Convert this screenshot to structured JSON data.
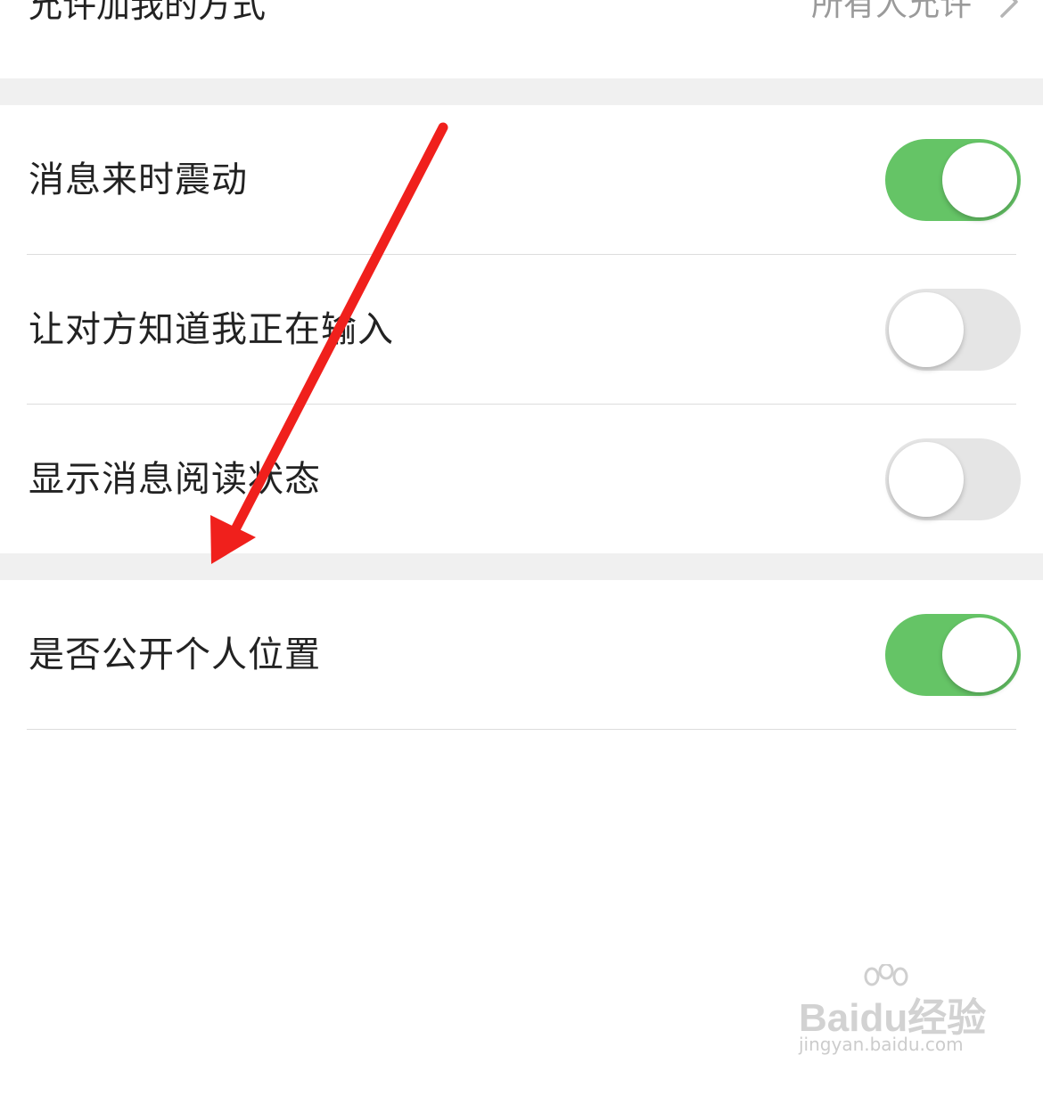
{
  "top_row": {
    "label": "允许加我的方式",
    "value": "所有人允许",
    "chevron_icon": "chevron-right-icon"
  },
  "settings": [
    {
      "label": "消息来时震动",
      "toggle_on": true
    },
    {
      "label": "让对方知道我正在输入",
      "toggle_on": false
    },
    {
      "label": "显示消息阅读状态",
      "toggle_on": false
    },
    {
      "label": "是否公开个人位置",
      "toggle_on": true
    }
  ],
  "colors": {
    "toggle_on": "#65c466",
    "toggle_off": "#e5e5e5",
    "annotation_arrow": "#f0201c",
    "section_gap": "#f0f0f0"
  },
  "annotation": {
    "icon": "red-arrow-icon"
  },
  "watermark": {
    "brand": "Baidu经验",
    "url": "jingyan.baidu.com"
  }
}
